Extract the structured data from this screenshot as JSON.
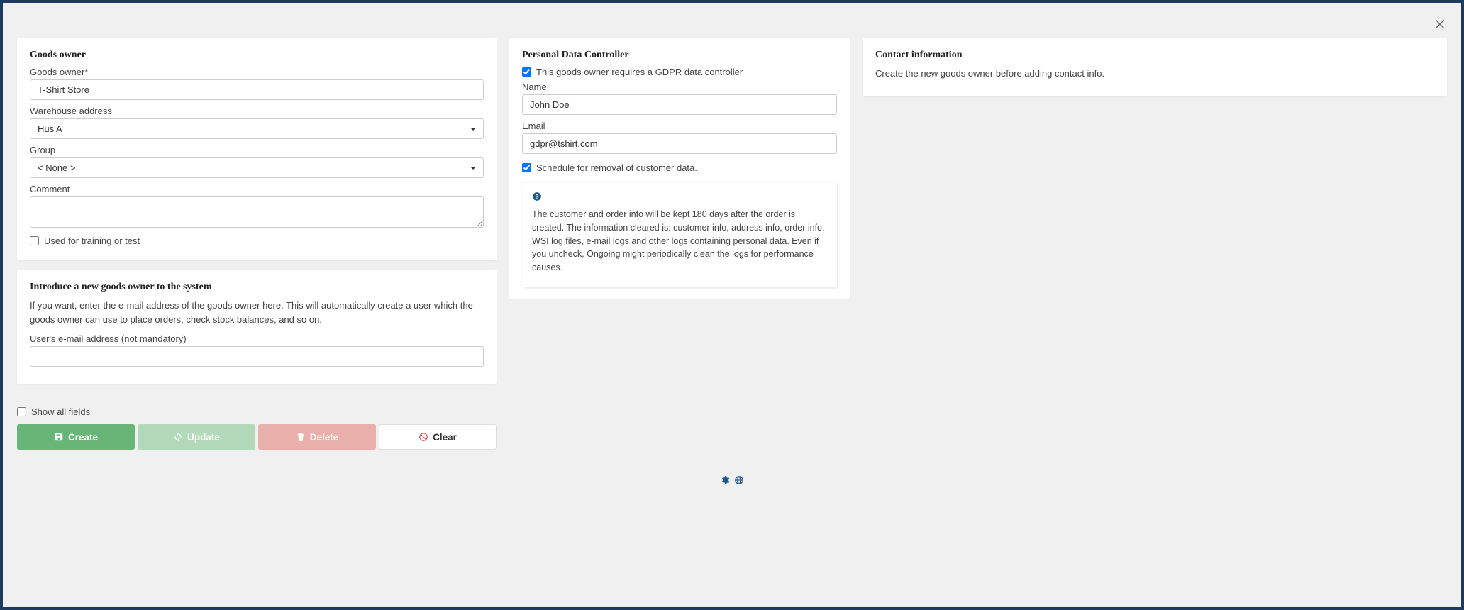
{
  "goodsOwner": {
    "title": "Goods owner",
    "nameLabel": "Goods owner*",
    "nameValue": "T-Shirt Store",
    "warehouseLabel": "Warehouse address",
    "warehouseValue": "Hus A",
    "groupLabel": "Group",
    "groupValue": "< None >",
    "commentLabel": "Comment",
    "commentValue": "",
    "trainingLabel": "Used for training or test"
  },
  "introduce": {
    "title": "Introduce a new goods owner to the system",
    "body": "If you want, enter the e-mail address of the goods owner here. This will automatically create a user which the goods owner can use to place orders, check stock balances, and so on.",
    "emailLabel": "User's e-mail address (not mandatory)",
    "emailValue": ""
  },
  "gdpr": {
    "title": "Personal Data Controller",
    "requireLabel": "This goods owner requires a GDPR data controller",
    "nameLabel": "Name",
    "nameValue": "John Doe",
    "emailLabel": "Email",
    "emailValue": "gdpr@tshirt.com",
    "scheduleLabel": "Schedule for removal of customer data.",
    "infoBody": "The customer and order info will be kept 180 days after the order is created. The information cleared is: customer info, address info, order info, WSI log files, e-mail logs and other logs containing personal data. Even if you uncheck, Ongoing might periodically clean the logs for performance causes."
  },
  "contact": {
    "title": "Contact information",
    "body": "Create the new goods owner before adding contact info."
  },
  "controls": {
    "showAll": "Show all fields",
    "create": "Create",
    "update": "Update",
    "delete": "Delete",
    "clear": "Clear"
  }
}
